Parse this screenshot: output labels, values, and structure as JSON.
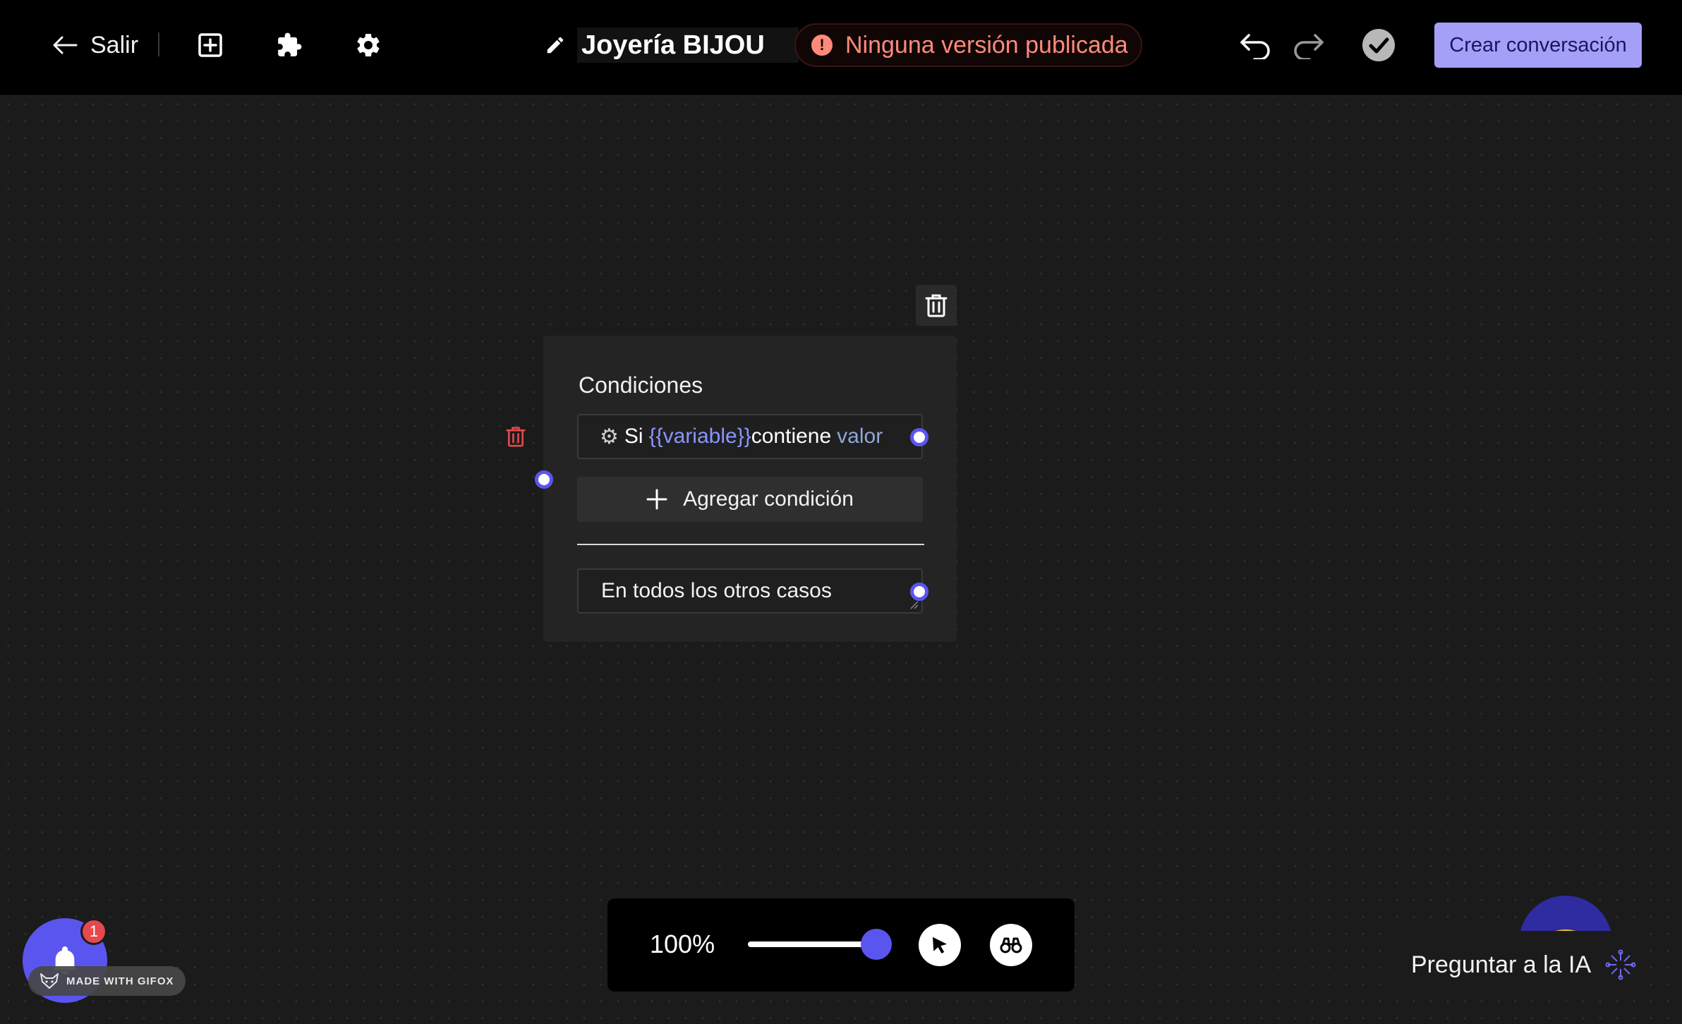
{
  "header": {
    "back_label": "Salir",
    "project_title": "Joyería BIJOU",
    "status_text": "Ninguna versión publicada",
    "create_button_label": "Crear conversación"
  },
  "node": {
    "title": "Condiciones",
    "condition": {
      "prefix": "Si",
      "variable": "{{variable}}",
      "operator": "contiene",
      "value": "valor"
    },
    "add_condition_label": "Agregar condición",
    "else_label": "En todos los otros casos"
  },
  "zoom": {
    "level_label": "100%",
    "level_fraction": 1.0
  },
  "notifications": {
    "count": "1"
  },
  "watermark": {
    "text": "MADE WITH GIFOX"
  },
  "assistant": {
    "label": "Preguntar a la IA"
  },
  "colors": {
    "accent": "#5b55f0",
    "primary_button": "#a5a0f7",
    "status_warning": "#ff8a7a",
    "badge": "#e5484d"
  },
  "icons": {
    "back": "arrow-left-icon",
    "add": "plus-square-icon",
    "plugins": "puzzle-icon",
    "settings": "gear-icon",
    "edit": "pencil-icon",
    "status": "alert-circle-icon",
    "undo": "undo-icon",
    "redo": "redo-icon",
    "validate": "check-circle-icon",
    "delete": "trash-icon",
    "pointer": "cursor-icon",
    "explore": "binoculars-icon",
    "bell": "bell-icon",
    "sparkle": "sparkle-icon"
  }
}
